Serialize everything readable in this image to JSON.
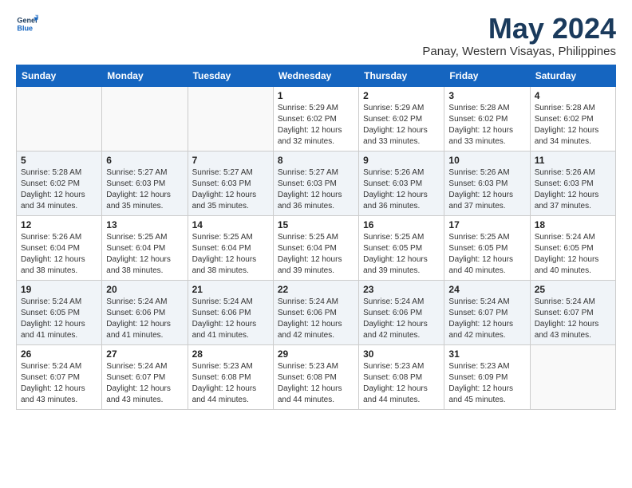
{
  "logo": {
    "line1": "General",
    "line2": "Blue"
  },
  "title": "May 2024",
  "subtitle": "Panay, Western Visayas, Philippines",
  "days_of_week": [
    "Sunday",
    "Monday",
    "Tuesday",
    "Wednesday",
    "Thursday",
    "Friday",
    "Saturday"
  ],
  "weeks": [
    [
      {
        "day": "",
        "info": ""
      },
      {
        "day": "",
        "info": ""
      },
      {
        "day": "",
        "info": ""
      },
      {
        "day": "1",
        "info": "Sunrise: 5:29 AM\nSunset: 6:02 PM\nDaylight: 12 hours\nand 32 minutes."
      },
      {
        "day": "2",
        "info": "Sunrise: 5:29 AM\nSunset: 6:02 PM\nDaylight: 12 hours\nand 33 minutes."
      },
      {
        "day": "3",
        "info": "Sunrise: 5:28 AM\nSunset: 6:02 PM\nDaylight: 12 hours\nand 33 minutes."
      },
      {
        "day": "4",
        "info": "Sunrise: 5:28 AM\nSunset: 6:02 PM\nDaylight: 12 hours\nand 34 minutes."
      }
    ],
    [
      {
        "day": "5",
        "info": "Sunrise: 5:28 AM\nSunset: 6:02 PM\nDaylight: 12 hours\nand 34 minutes."
      },
      {
        "day": "6",
        "info": "Sunrise: 5:27 AM\nSunset: 6:03 PM\nDaylight: 12 hours\nand 35 minutes."
      },
      {
        "day": "7",
        "info": "Sunrise: 5:27 AM\nSunset: 6:03 PM\nDaylight: 12 hours\nand 35 minutes."
      },
      {
        "day": "8",
        "info": "Sunrise: 5:27 AM\nSunset: 6:03 PM\nDaylight: 12 hours\nand 36 minutes."
      },
      {
        "day": "9",
        "info": "Sunrise: 5:26 AM\nSunset: 6:03 PM\nDaylight: 12 hours\nand 36 minutes."
      },
      {
        "day": "10",
        "info": "Sunrise: 5:26 AM\nSunset: 6:03 PM\nDaylight: 12 hours\nand 37 minutes."
      },
      {
        "day": "11",
        "info": "Sunrise: 5:26 AM\nSunset: 6:03 PM\nDaylight: 12 hours\nand 37 minutes."
      }
    ],
    [
      {
        "day": "12",
        "info": "Sunrise: 5:26 AM\nSunset: 6:04 PM\nDaylight: 12 hours\nand 38 minutes."
      },
      {
        "day": "13",
        "info": "Sunrise: 5:25 AM\nSunset: 6:04 PM\nDaylight: 12 hours\nand 38 minutes."
      },
      {
        "day": "14",
        "info": "Sunrise: 5:25 AM\nSunset: 6:04 PM\nDaylight: 12 hours\nand 38 minutes."
      },
      {
        "day": "15",
        "info": "Sunrise: 5:25 AM\nSunset: 6:04 PM\nDaylight: 12 hours\nand 39 minutes."
      },
      {
        "day": "16",
        "info": "Sunrise: 5:25 AM\nSunset: 6:05 PM\nDaylight: 12 hours\nand 39 minutes."
      },
      {
        "day": "17",
        "info": "Sunrise: 5:25 AM\nSunset: 6:05 PM\nDaylight: 12 hours\nand 40 minutes."
      },
      {
        "day": "18",
        "info": "Sunrise: 5:24 AM\nSunset: 6:05 PM\nDaylight: 12 hours\nand 40 minutes."
      }
    ],
    [
      {
        "day": "19",
        "info": "Sunrise: 5:24 AM\nSunset: 6:05 PM\nDaylight: 12 hours\nand 41 minutes."
      },
      {
        "day": "20",
        "info": "Sunrise: 5:24 AM\nSunset: 6:06 PM\nDaylight: 12 hours\nand 41 minutes."
      },
      {
        "day": "21",
        "info": "Sunrise: 5:24 AM\nSunset: 6:06 PM\nDaylight: 12 hours\nand 41 minutes."
      },
      {
        "day": "22",
        "info": "Sunrise: 5:24 AM\nSunset: 6:06 PM\nDaylight: 12 hours\nand 42 minutes."
      },
      {
        "day": "23",
        "info": "Sunrise: 5:24 AM\nSunset: 6:06 PM\nDaylight: 12 hours\nand 42 minutes."
      },
      {
        "day": "24",
        "info": "Sunrise: 5:24 AM\nSunset: 6:07 PM\nDaylight: 12 hours\nand 42 minutes."
      },
      {
        "day": "25",
        "info": "Sunrise: 5:24 AM\nSunset: 6:07 PM\nDaylight: 12 hours\nand 43 minutes."
      }
    ],
    [
      {
        "day": "26",
        "info": "Sunrise: 5:24 AM\nSunset: 6:07 PM\nDaylight: 12 hours\nand 43 minutes."
      },
      {
        "day": "27",
        "info": "Sunrise: 5:24 AM\nSunset: 6:07 PM\nDaylight: 12 hours\nand 43 minutes."
      },
      {
        "day": "28",
        "info": "Sunrise: 5:23 AM\nSunset: 6:08 PM\nDaylight: 12 hours\nand 44 minutes."
      },
      {
        "day": "29",
        "info": "Sunrise: 5:23 AM\nSunset: 6:08 PM\nDaylight: 12 hours\nand 44 minutes."
      },
      {
        "day": "30",
        "info": "Sunrise: 5:23 AM\nSunset: 6:08 PM\nDaylight: 12 hours\nand 44 minutes."
      },
      {
        "day": "31",
        "info": "Sunrise: 5:23 AM\nSunset: 6:09 PM\nDaylight: 12 hours\nand 45 minutes."
      },
      {
        "day": "",
        "info": ""
      }
    ]
  ]
}
